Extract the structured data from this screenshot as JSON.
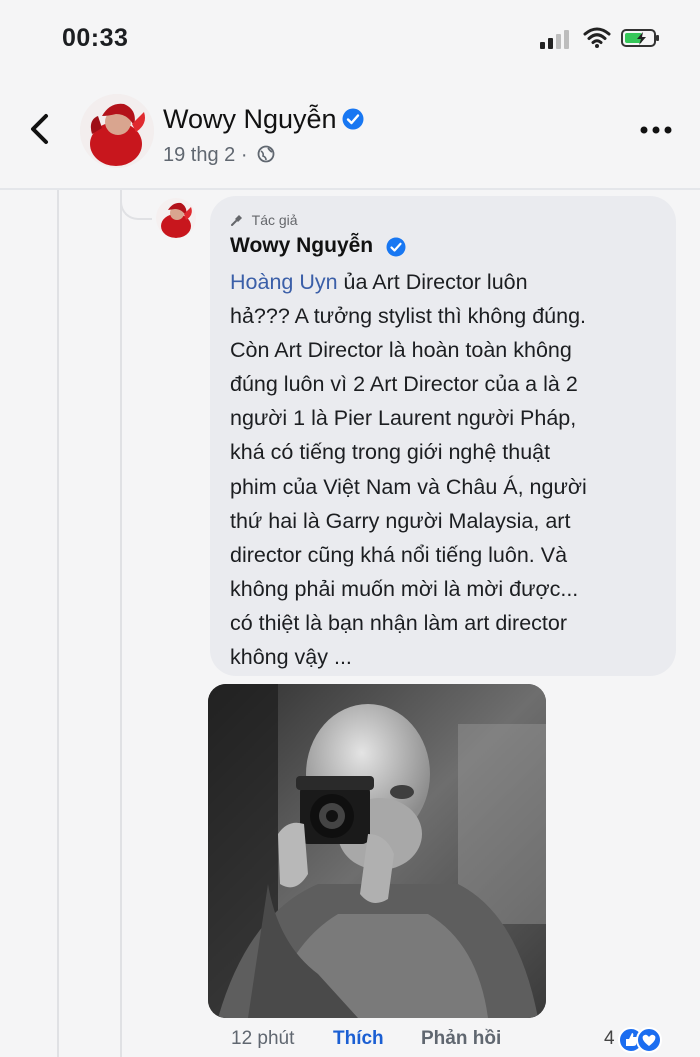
{
  "status_bar": {
    "time": "00:33"
  },
  "post": {
    "author": "Wowy Nguyễn",
    "date": "19 thg 2 ·"
  },
  "comment": {
    "author_tag": "Tác giả",
    "author": "Wowy Nguyễn",
    "mention": "Hoàng Uyn",
    "text_lines": [
      " ủa Art Director luôn",
      "hả??? A tưởng stylist thì không đúng.",
      "Còn Art Director là hoàn toàn không",
      "đúng luôn vì 2 Art Director của a là 2",
      "người 1 là Pier Laurent người Pháp,",
      "khá có tiếng trong giới nghệ thuật",
      "phim của Việt Nam và Châu Á, người",
      "thứ hai là Garry người Malaysia, art",
      "director cũng khá nổi tiếng luôn. Và",
      "không phải muốn mời là mời được...",
      "có thiệt là bạn nhận làm art director",
      "không vậy ..."
    ],
    "time": "12 phút",
    "like_label": "Thích",
    "reply_label": "Phản hồi",
    "reaction_count": "4"
  },
  "colors": {
    "mention": "#3b5fa8",
    "like": "#1b5fd3",
    "verified": "#1877f2",
    "bubble": "#eaebef"
  },
  "icons": [
    "back-icon",
    "more-icon",
    "globe-icon",
    "verified-icon",
    "mic-icon",
    "signal-icon",
    "wifi-icon",
    "battery-icon",
    "like-reaction-icon",
    "love-reaction-icon"
  ]
}
